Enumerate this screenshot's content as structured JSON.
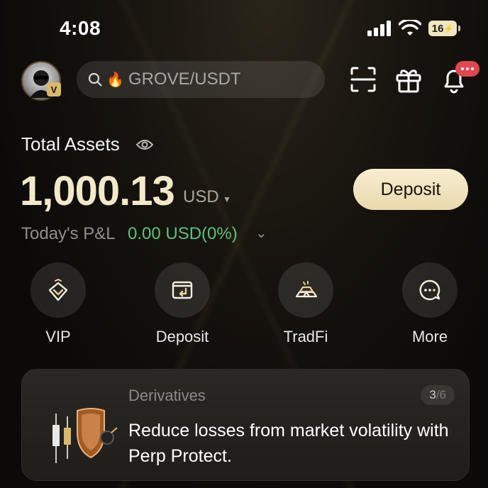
{
  "status_bar": {
    "time": "4:08",
    "battery": "16"
  },
  "header": {
    "search_placeholder": "GROVE/USDT",
    "avatar_badge": "V"
  },
  "assets": {
    "title": "Total Assets",
    "amount": "1,000.13",
    "currency": "USD",
    "deposit_button": "Deposit",
    "pnl_label": "Today's P&L",
    "pnl_value": "0.00 USD(0%)"
  },
  "quick_actions": [
    {
      "label": "VIP",
      "icon": "vip-diamond-icon"
    },
    {
      "label": "Deposit",
      "icon": "wallet-icon"
    },
    {
      "label": "TradFi",
      "icon": "gold-bars-icon"
    },
    {
      "label": "More",
      "icon": "more-chat-icon"
    }
  ],
  "banner": {
    "category": "Derivatives",
    "counter_current": "3",
    "counter_total": "/6",
    "text": "Reduce losses from market volatility with Perp Protect."
  },
  "colors": {
    "accent_gold": "#f3e9c9",
    "profit_green": "#5cc07d",
    "notification_red": "#e0474f"
  }
}
